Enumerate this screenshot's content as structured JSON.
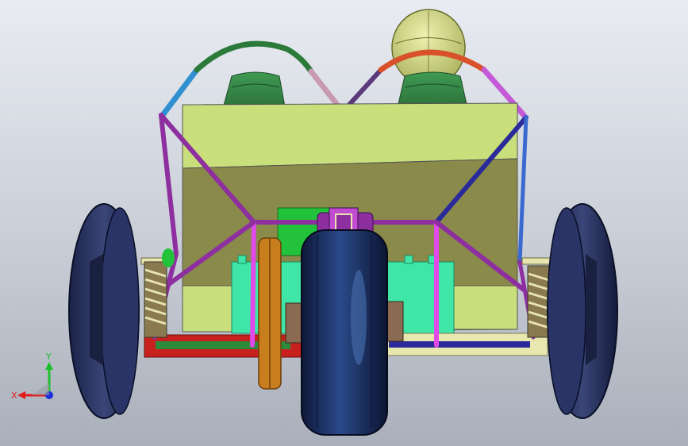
{
  "viewport": {
    "background_top": "#e9ecf2",
    "background_bottom": "#aab0bb"
  },
  "triad": {
    "x_label": "X",
    "y_label": "Y",
    "x_color": "#e01c1c",
    "y_color": "#1cbf2a",
    "z_color": "#1c2fd8"
  },
  "model": {
    "body_color": "#c9df7b",
    "body_shade_color": "#8c8c4c",
    "tire_color": "#1f2a52",
    "frame_colors": [
      "#8e2fa0",
      "#c14bd1",
      "#2a2a9a",
      "#4fa0c8",
      "#d0533a",
      "#2e8a3a"
    ]
  }
}
